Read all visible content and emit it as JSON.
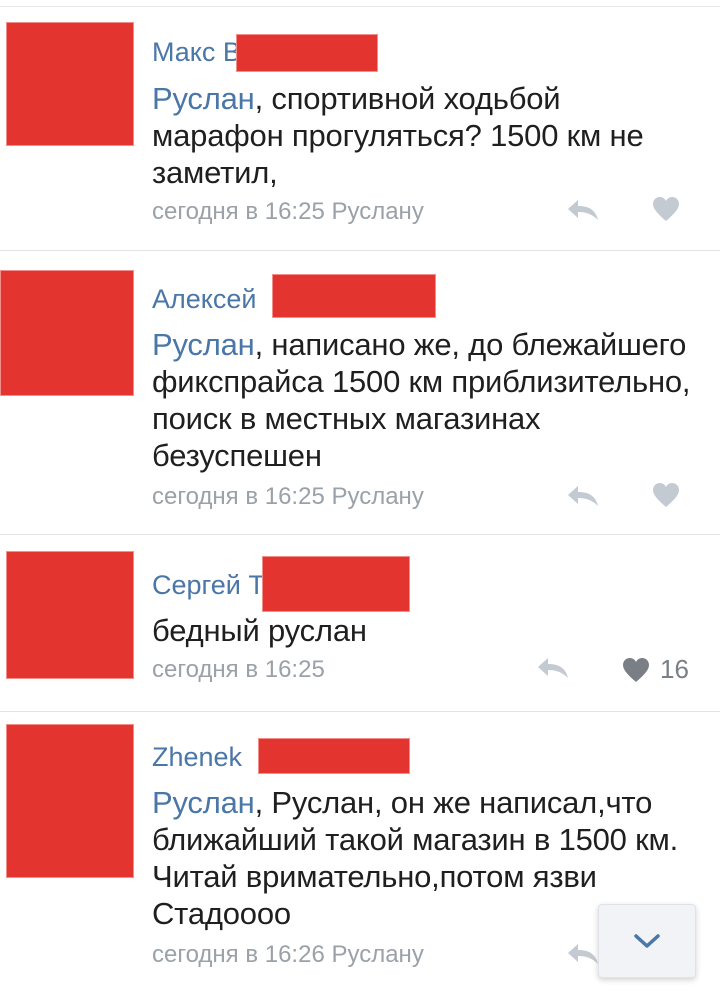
{
  "comments": [
    {
      "author": "Макс В",
      "mention": "Руслан",
      "text": ", спортивной ходьбой марафон прогуляться? 1500 км не заметил,",
      "time": "сегодня в 16:25",
      "reply_to": "Руслану",
      "likes": ""
    },
    {
      "author": "Алексей",
      "mention": "Руслан",
      "text": ", написано же, до блежайшего фикспрайса 1500 км приблизительно, поиск в местных магазинах безуспешен",
      "time": "сегодня в 16:25",
      "reply_to": "Руслану",
      "likes": ""
    },
    {
      "author": "Сергей Т",
      "mention": "",
      "text": "бедный руслан",
      "time": "сегодня в 16:25",
      "reply_to": "",
      "likes": "16"
    },
    {
      "author": "Zhenek",
      "mention": "Руслан",
      "text": ", Руслан, он же написал,что ближайший такой магазин в 1500 км. Читай вримательно,потом язви Стадоооо",
      "time": "сегодня в 16:26",
      "reply_to": "Руслану",
      "likes": ""
    }
  ],
  "colors": {
    "link": "#4a76a8",
    "redaction": "#e3342f",
    "meta": "#9aa1a8",
    "icon": "#c4cad1",
    "icon_liked": "#7a7f85"
  },
  "icons": {
    "reply": "reply-arrow-icon",
    "like": "heart-icon",
    "scroll": "chevron-down-icon"
  }
}
